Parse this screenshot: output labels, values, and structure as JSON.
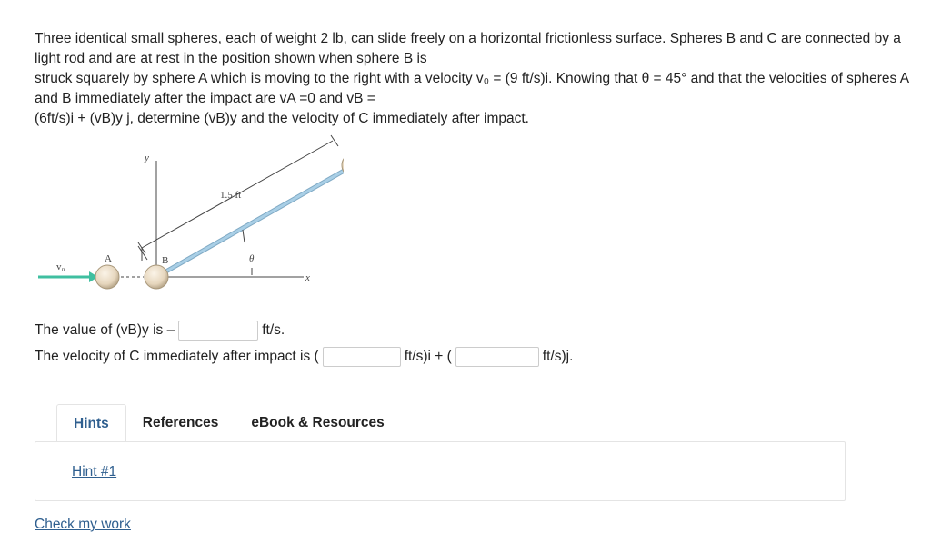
{
  "problem": {
    "line1": "Three identical small spheres, each of weight 2 lb, can slide freely on a horizontal frictionless surface. Spheres B and C are connected by a light rod and are at rest in the position shown when sphere B is",
    "line2": "struck squarely by sphere A which is moving to the right with a velocity v₀ = (9 ft/s)i. Knowing that θ = 45° and that the velocities of spheres A and B immediately after the impact are vA =0 and vB =",
    "line3": "(6ft/s)i + (vB)y j, determine (vB)y and the velocity of C immediately after impact."
  },
  "figure": {
    "label_y": "y",
    "label_x": "x",
    "label_c": "C",
    "label_a": "A",
    "label_b": "B",
    "label_v0": "v₀",
    "label_length": "1.5 ft",
    "label_theta": "θ",
    "colors": {
      "rod": "#a9cfe6",
      "sphere": "#e6d6bd",
      "arrow": "#3fbfa0"
    }
  },
  "question1": {
    "prefix": "The value of (vB)y is –",
    "unit": "ft/s.",
    "value": ""
  },
  "question2": {
    "prefix": "The velocity of C immediately after impact is (",
    "mid": "ft/s)i + (",
    "suffix": "ft/s)j.",
    "value_x": "",
    "value_y": ""
  },
  "tabs": [
    "Hints",
    "References",
    "eBook & Resources"
  ],
  "hint_link": "Hint #1",
  "check_link": "Check my work"
}
